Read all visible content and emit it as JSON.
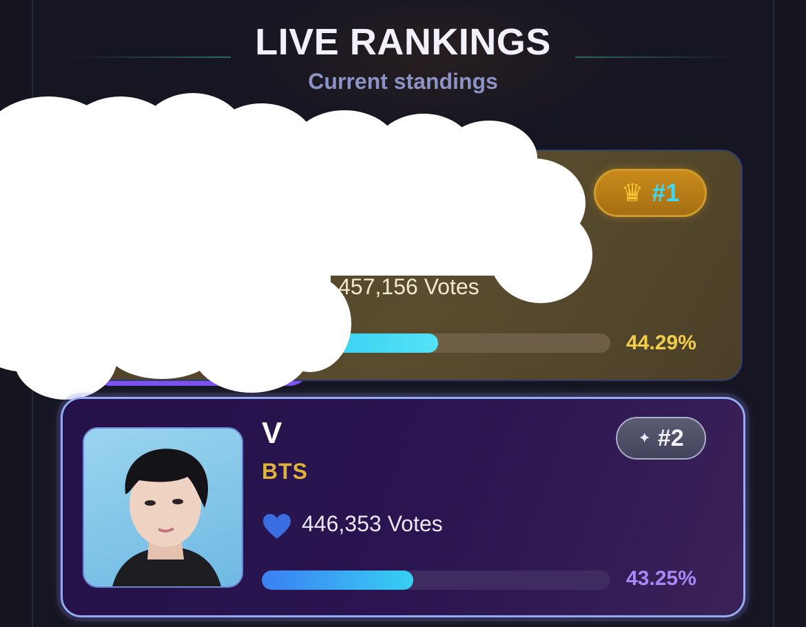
{
  "header": {
    "title": "LIVE RANKINGS",
    "subtitle": "Current standings"
  },
  "rankings": [
    {
      "rank_label": "#1",
      "rank_icon": "crown-icon",
      "votes_text": "457,156 Votes",
      "percent_text": "44.29%",
      "progress_fraction": 0.506,
      "accent_color": "#f2cc4b"
    },
    {
      "rank_label": "#2",
      "rank_icon": "sparkle-icon",
      "name": "V",
      "group": "BTS",
      "votes_icon": "heart-icon",
      "votes_text": "446,353 Votes",
      "percent_text": "43.25%",
      "progress_fraction": 0.435,
      "accent_color": "#a789f6"
    }
  ]
}
